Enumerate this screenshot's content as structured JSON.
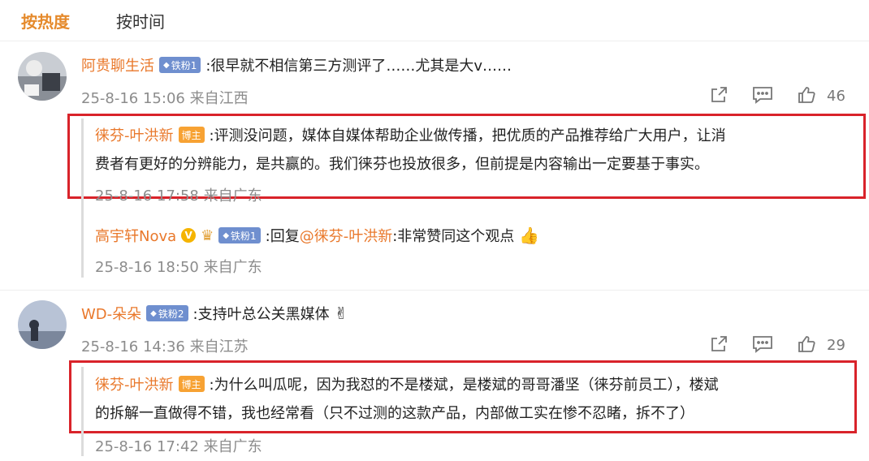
{
  "tabs": {
    "hot": "按热度",
    "time": "按时间"
  },
  "comment1": {
    "user": "阿贵聊生活",
    "fan_badge": "铁粉1",
    "text": ":很早就不相信第三方测评了……尤其是大v……",
    "time": "25-8-16 15:06",
    "location": "来自江西",
    "like_count": "46",
    "replies": [
      {
        "user": "徕芬-叶洪新",
        "badge": "博主",
        "text_line1": ":评测没问题，媒体自媒体帮助企业做传播，把优质的产品推荐给广大用户，让消",
        "text_line2": "费者有更好的分辨能力，是共赢的。我们徕芬也投放很多，但前提是内容输出一定要基于事实。",
        "time": "25-8-16 17:58",
        "location": "来自广东"
      },
      {
        "user": "高宇轩Nova",
        "fan_badge": "铁粉1",
        "text_prefix": ":回复",
        "mention": "@徕芬-叶洪新",
        "text_suffix": ":非常赞同这个观点",
        "emoji": "👍",
        "time": "25-8-16 18:50",
        "location": "来自广东"
      }
    ]
  },
  "comment2": {
    "user": "WD-朵朵",
    "fan_badge": "铁粉2",
    "text": ":支持叶总公关黑媒体",
    "emoji": "✌",
    "time": "25-8-16 14:36",
    "location": "来自江苏",
    "like_count": "29",
    "reply": {
      "user": "徕芬-叶洪新",
      "badge": "博主",
      "text_line1": ":为什么叫瓜呢，因为我怼的不是楼斌，是楼斌的哥哥潘坚（徕芬前员工），楼斌",
      "text_line2": "的拆解一直做得不错，我也经常看（只不过测的这款产品，内部做工实在惨不忍睹，拆不了）",
      "time": "25-8-16 17:42",
      "location": "来自广东"
    }
  },
  "colors": {
    "accent": "#e9782b",
    "highlight_box": "#d9232a",
    "fan_badge": "#6f8fcf",
    "blogger_badge": "#f7a233"
  },
  "icons": [
    "share-icon",
    "comment-icon",
    "like-icon",
    "vip-v-icon",
    "crown-icon",
    "diamond-icon"
  ]
}
